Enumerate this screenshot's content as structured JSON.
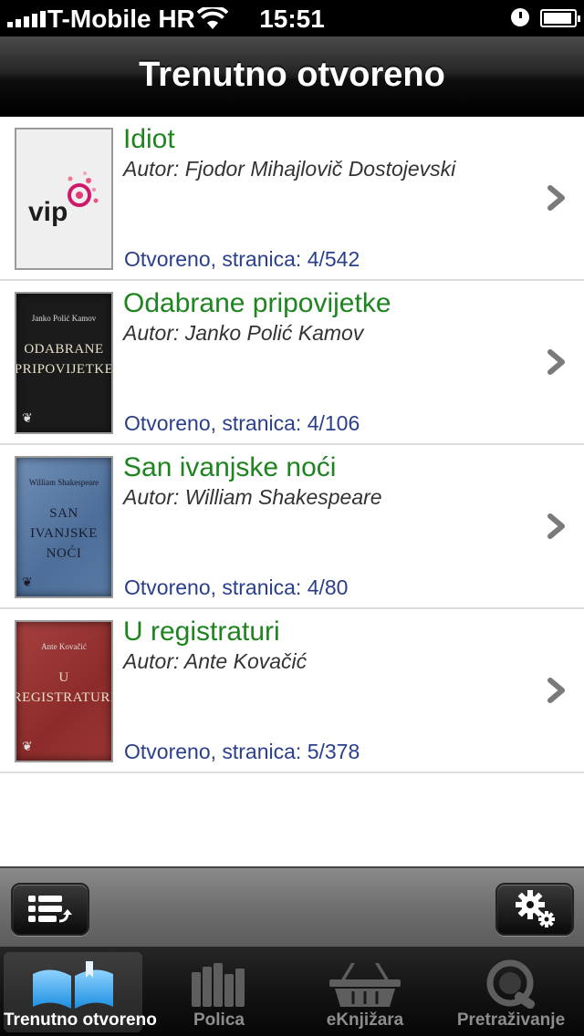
{
  "status_bar": {
    "carrier": "T-Mobile HR",
    "time": "15:51",
    "battery_level": 0.95
  },
  "nav": {
    "title": "Trenutno otvoreno"
  },
  "books": [
    {
      "title": "Idiot",
      "author": "Autor: Fjodor Mihajlovič Dostojevski",
      "status": "Otvoreno, stranica: 4/542",
      "cover_type": "vip",
      "cover_text": "vip"
    },
    {
      "title": "Odabrane pripovijetke",
      "author": "Autor: Janko Polić Kamov",
      "status": "Otvoreno, stranica: 4/106",
      "cover_type": "black",
      "cover_author": "Janko Polić Kamov",
      "cover_title": "Odabrane pripovijetke"
    },
    {
      "title": "San ivanjske noći",
      "author": "Autor: William Shakespeare",
      "status": "Otvoreno, stranica: 4/80",
      "cover_type": "blue",
      "cover_author": "William Shakespeare",
      "cover_title": "San ivanjske noći"
    },
    {
      "title": "U registraturi",
      "author": "Autor: Ante Kovačić",
      "status": "Otvoreno, stranica: 5/378",
      "cover_type": "red",
      "cover_author": "Ante Kovačić",
      "cover_title": "U registraturi"
    }
  ],
  "toolbar": {
    "left_icon": "list-icon",
    "right_icon": "settings-gears-icon"
  },
  "tabs": [
    {
      "label": "Trenutno otvoreno",
      "icon": "open-book-icon",
      "active": true
    },
    {
      "label": "Polica",
      "icon": "bookshelf-icon",
      "active": false
    },
    {
      "label": "eKnjižara",
      "icon": "basket-icon",
      "active": false
    },
    {
      "label": "Pretraživanje",
      "icon": "search-icon",
      "active": false
    }
  ],
  "colors": {
    "title_green": "#1e8420",
    "status_blue": "#2a3f8c",
    "vip_magenta": "#d0186a"
  }
}
